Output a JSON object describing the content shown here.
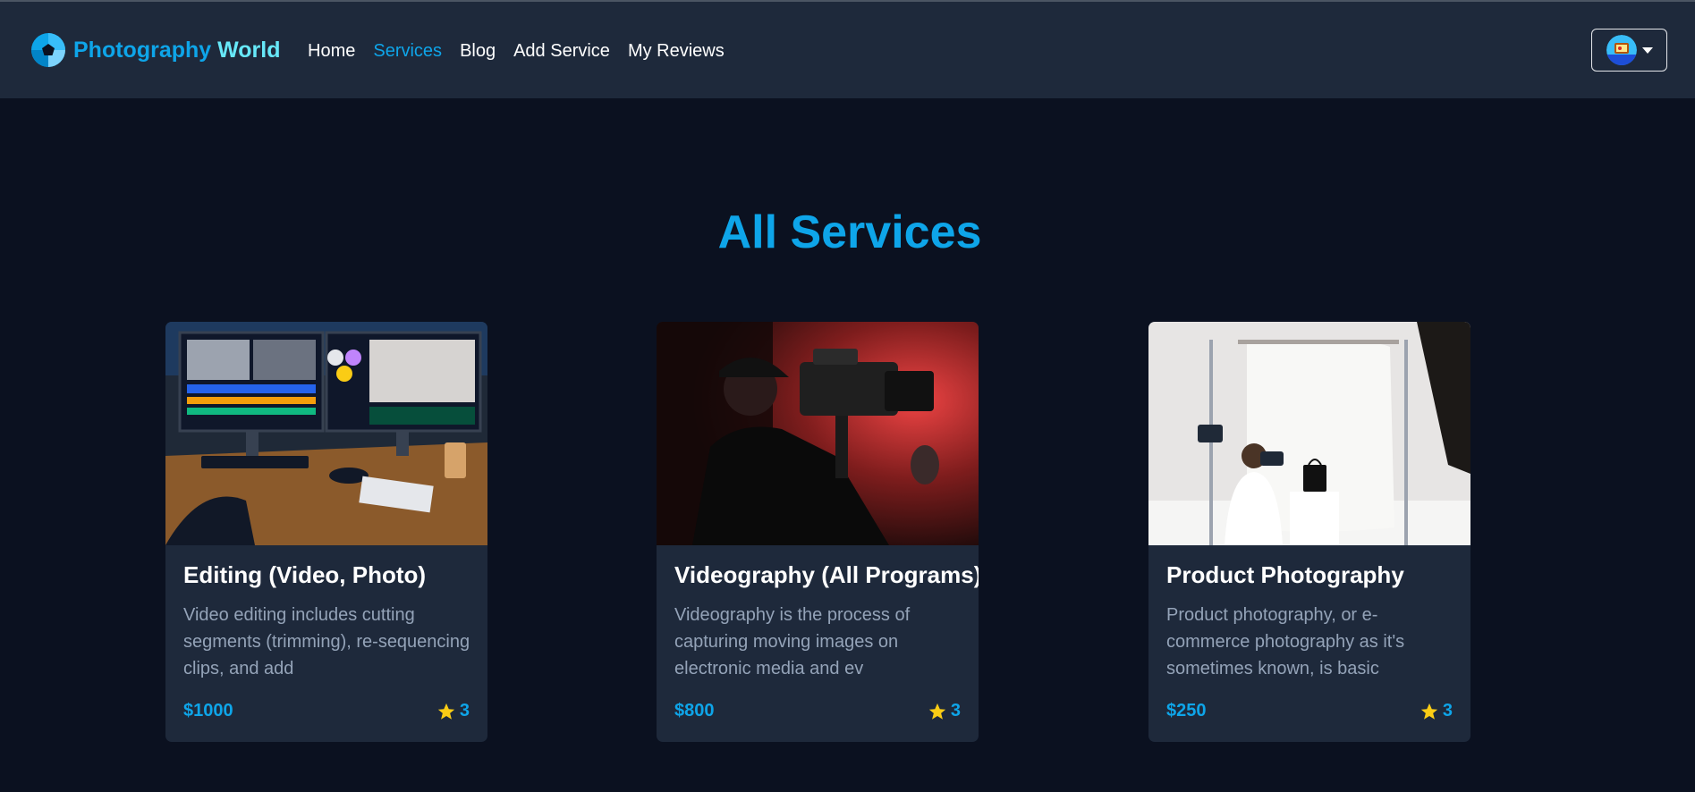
{
  "brand": {
    "name_part1": "Photography",
    "name_part2": "World",
    "logo_icon": "camera-shutter-icon"
  },
  "nav": {
    "items": [
      {
        "label": "Home",
        "active": false
      },
      {
        "label": "Services",
        "active": true
      },
      {
        "label": "Blog",
        "active": false
      },
      {
        "label": "Add Service",
        "active": false
      },
      {
        "label": "My Reviews",
        "active": false
      }
    ]
  },
  "user_menu": {
    "icon": "user-avatar",
    "caret_icon": "caret-down-icon"
  },
  "main": {
    "title": "All Services",
    "services": [
      {
        "title": "Editing (Video, Photo)",
        "description": "Video editing includes cutting segments (trimming), re-sequencing clips, and add",
        "price": "$1000",
        "rating": "3",
        "image": "video-editing-desk-photo"
      },
      {
        "title": "Videography (All Programs)",
        "description": "Videography is the process of capturing moving images on electronic media and ev",
        "price": "$800",
        "rating": "3",
        "image": "camera-operator-photo"
      },
      {
        "title": "Product Photography",
        "description": "Product photography, or e-commerce photography as it's sometimes known, is basic",
        "price": "$250",
        "rating": "3",
        "image": "product-studio-photo"
      }
    ]
  },
  "colors": {
    "page_bg": "#0b1120",
    "navbar_bg": "#1e293b",
    "card_bg": "#1e293b",
    "accent": "#0ea5e9",
    "star": "#facc15"
  }
}
